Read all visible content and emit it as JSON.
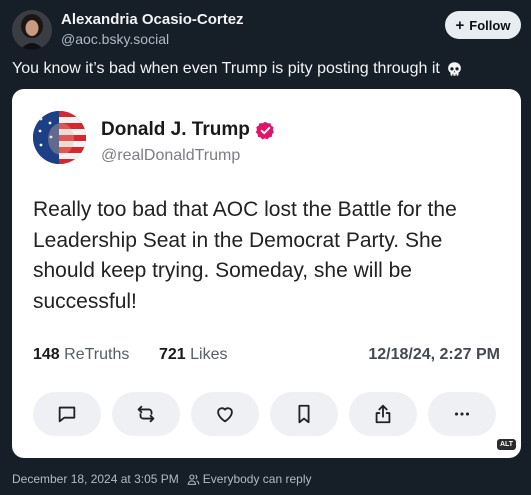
{
  "author": {
    "name": "Alexandria Ocasio-Cortez",
    "handle": "@aoc.bsky.social"
  },
  "follow_button": {
    "label": "Follow",
    "icon": "plus-icon"
  },
  "post": {
    "text": "You know it’s bad when even Trump is pity posting through it",
    "emoji": "skull-icon"
  },
  "embedded_truth": {
    "name": "Donald J. Trump",
    "handle": "@realDonaldTrump",
    "text": "Really too bad that AOC lost the Battle for the Leadership Seat in the Democrat Party. She should keep trying. Someday, she will be successful!",
    "retruths_count": "148",
    "retruths_label": "ReTruths",
    "likes_count": "721",
    "likes_label": "Likes",
    "date": "12/18/24, 2:27 PM",
    "actions": [
      "reply-icon",
      "retruth-icon",
      "like-icon",
      "bookmark-icon",
      "share-icon",
      "more-icon"
    ],
    "alt_badge": "ALT"
  },
  "footer": {
    "timestamp": "December 18, 2024 at 3:05 PM",
    "reply_setting": "Everybody can reply"
  },
  "colors": {
    "background": "#161e27",
    "card": "#ffffff",
    "verified": "#e0156a",
    "muted_text": "#aebbc9"
  }
}
